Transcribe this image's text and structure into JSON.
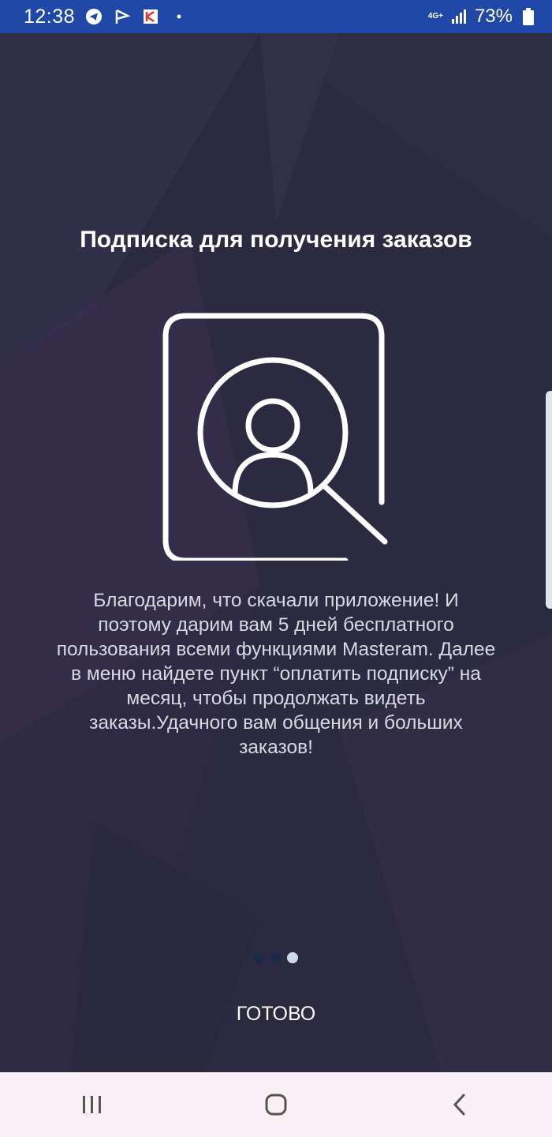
{
  "status_bar": {
    "time": "12:38",
    "battery": "73%",
    "network": "4G+",
    "icons": [
      "telegram-icon",
      "flag-icon",
      "app-notification-icon",
      "dot-icon",
      "signal-icon",
      "battery-icon"
    ],
    "background_color": "#1f48a8"
  },
  "onboarding": {
    "title": "Подписка для получения заказов",
    "illustration_icon": "profile-search-icon",
    "description": "Благодарим, что скачали приложение! И поэтому дарим вам 5 дней бесплатного пользования всеми функциями Masteram. Далее в меню найдете пункт “оплатить подписку” на месяц, чтобы продолжать видеть заказы.Удачного вам общения и больших заказов!",
    "pager": {
      "total": 3,
      "active_index": 2
    },
    "done_label": "ГОТОВО",
    "background_color": "#2b2a40"
  },
  "nav_bar": {
    "buttons": [
      "recent-apps-icon",
      "home-icon",
      "back-icon"
    ],
    "background_color": "#fbf0f5"
  }
}
